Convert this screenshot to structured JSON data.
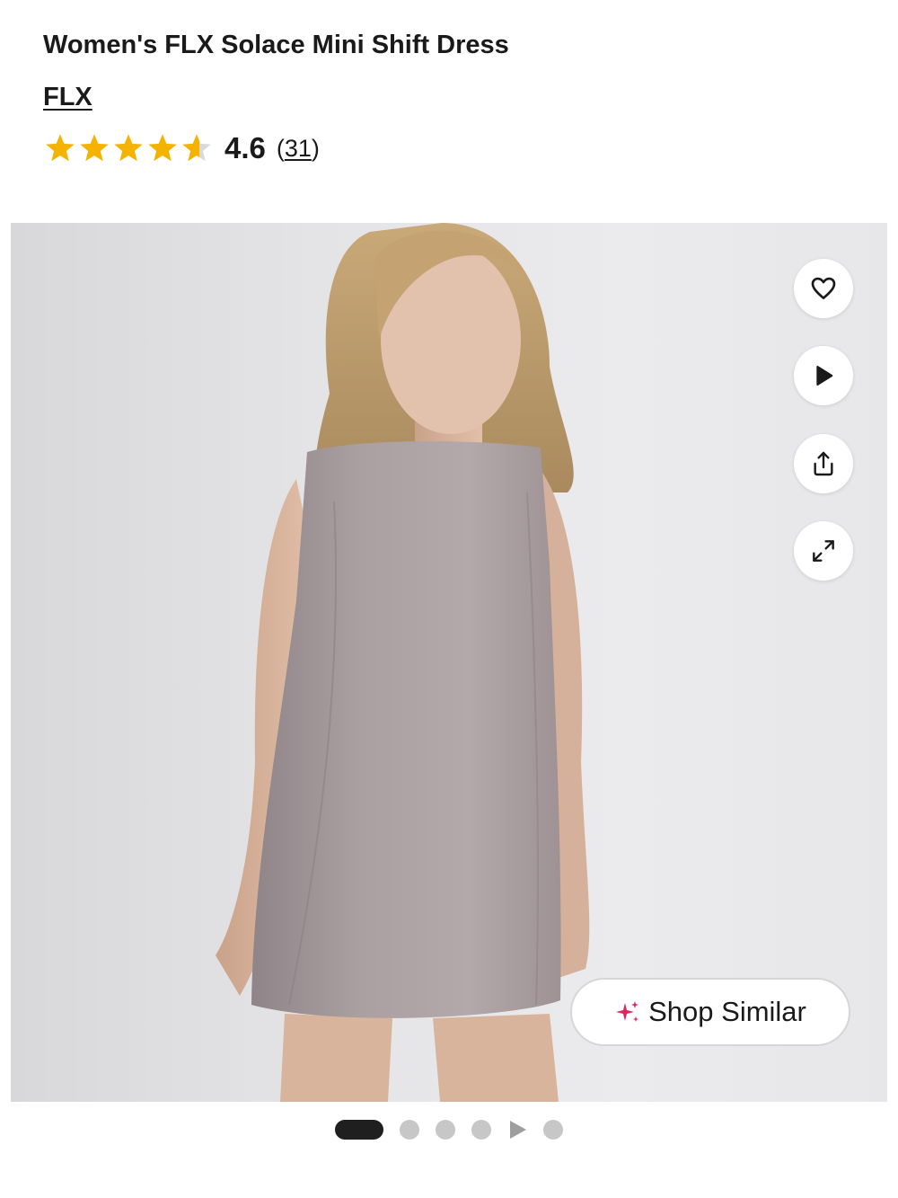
{
  "product": {
    "title": "Women's FLX Solace Mini Shift Dress",
    "brand": "FLX",
    "rating": 4.6,
    "rating_text": "4.6",
    "review_count_prefix": "(",
    "review_count": "31",
    "review_count_suffix": ")",
    "star_color": "#f5b301",
    "star_empty_color": "#d9d9d9"
  },
  "gallery": {
    "actions": [
      {
        "name": "favorite",
        "icon": "heart-icon"
      },
      {
        "name": "play-video",
        "icon": "play-icon"
      },
      {
        "name": "share",
        "icon": "share-icon"
      },
      {
        "name": "expand",
        "icon": "expand-icon"
      }
    ],
    "shop_similar_label": "Shop Similar",
    "shop_similar_icon": "sparkle-icon",
    "sparkle_color": "#e0245e",
    "image_count": 6,
    "current_index": 0,
    "video_index": 4
  }
}
